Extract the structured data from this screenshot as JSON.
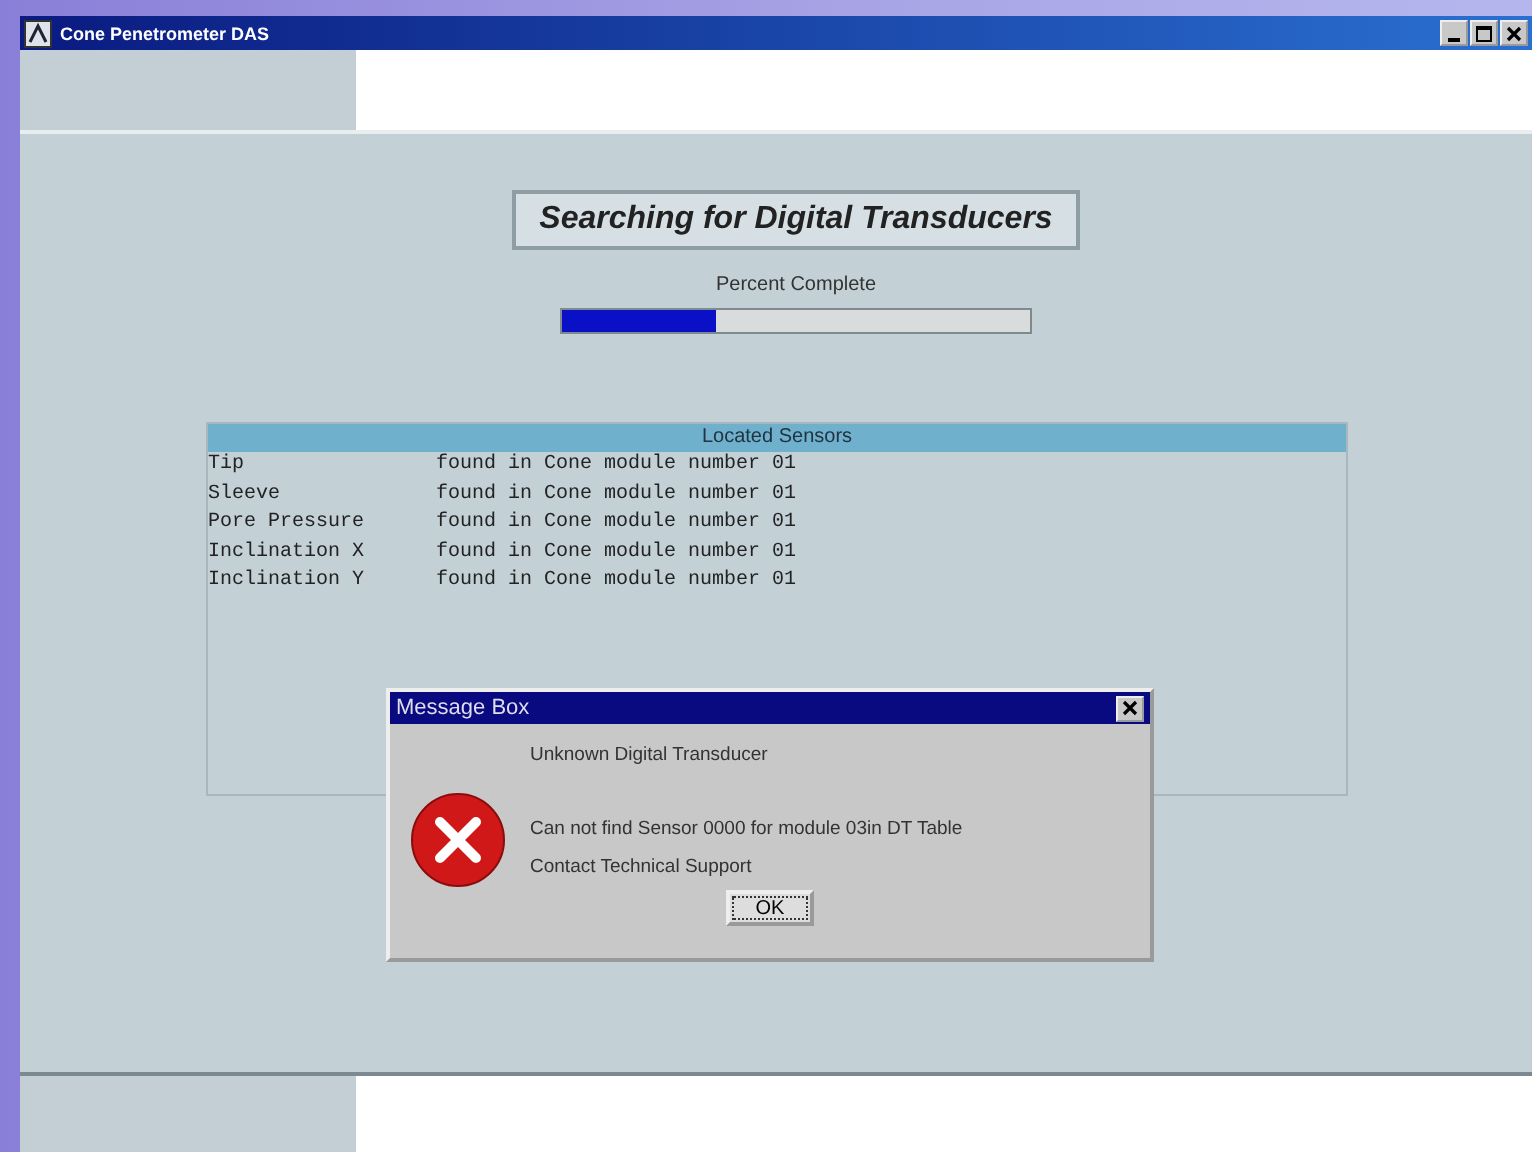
{
  "window": {
    "title": "Cone Penetrometer DAS"
  },
  "heading": "Searching for Digital Transducers",
  "progress": {
    "label": "Percent Complete",
    "level": 0.33
  },
  "sensors": {
    "title": "Located Sensors",
    "rows": [
      {
        "name": "Tip",
        "status": "found in Cone module number 01"
      },
      {
        "name": "Sleeve",
        "status": "found in Cone module number 01"
      },
      {
        "name": "Pore Pressure",
        "status": "found in Cone module number 01"
      },
      {
        "name": "Inclination X",
        "status": "found in Cone module number 01"
      },
      {
        "name": "Inclination Y",
        "status": "found in Cone module number 01"
      }
    ]
  },
  "dialog": {
    "title": "Message Box",
    "kind": "error",
    "lines": [
      "Unknown Digital Transducer",
      "Can not find Sensor 0000 for module 03in DT Table",
      "Contact Technical Support"
    ],
    "button": "OK"
  }
}
